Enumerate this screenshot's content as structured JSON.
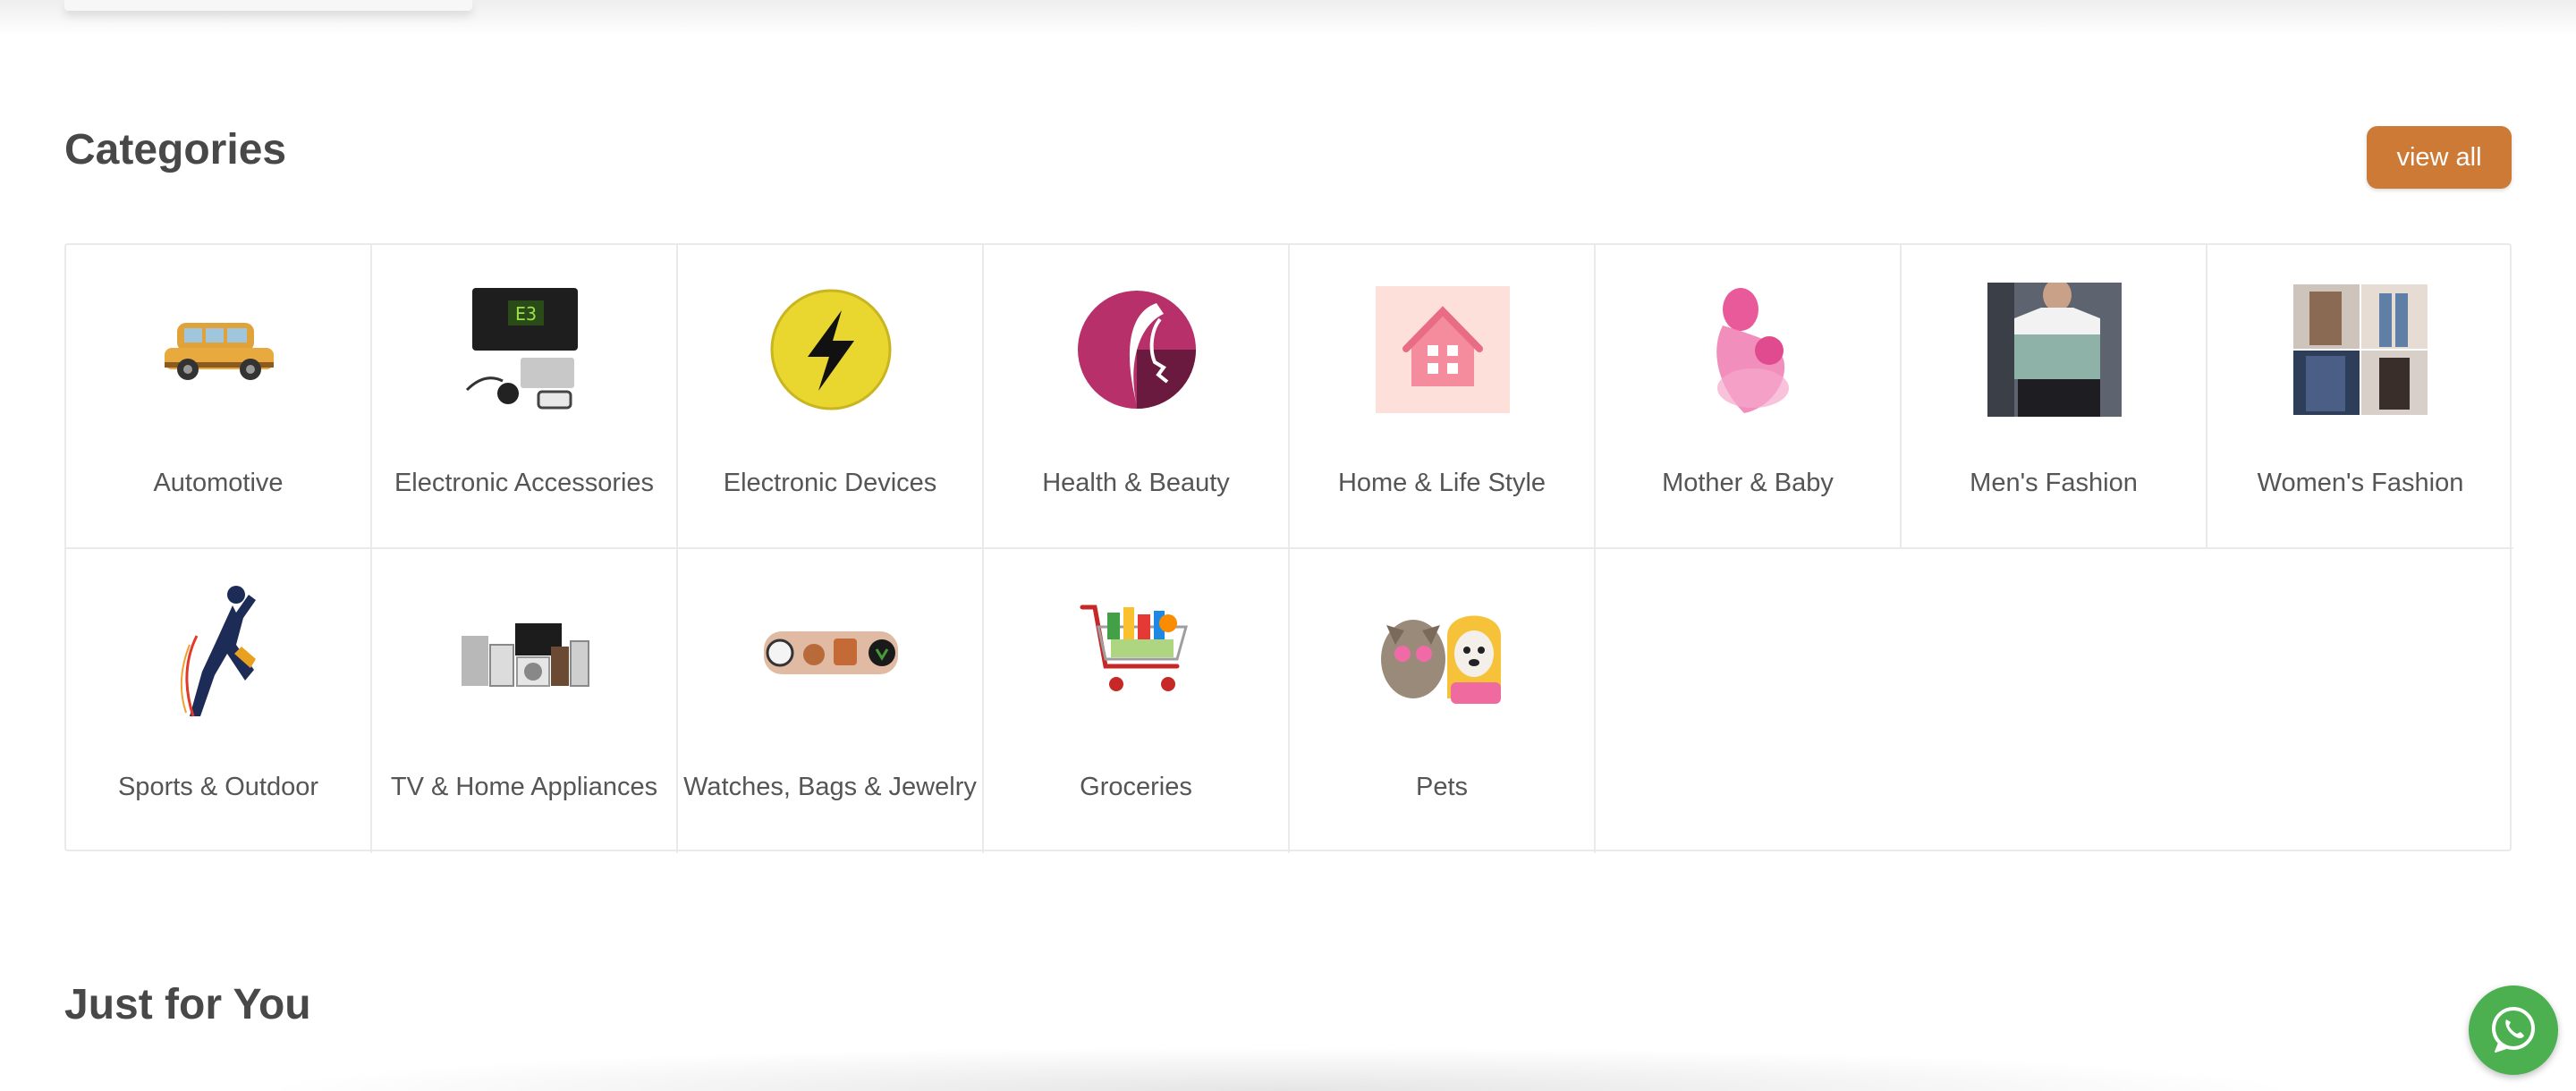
{
  "categories_section": {
    "title": "Categories",
    "view_all_label": "view all",
    "items": [
      {
        "label": "Automotive",
        "icon": "car-icon"
      },
      {
        "label": "Electronic Accessories",
        "icon": "electronic-accessories-icon"
      },
      {
        "label": "Electronic Devices",
        "icon": "lightning-icon"
      },
      {
        "label": "Health & Beauty",
        "icon": "woman-profile-icon"
      },
      {
        "label": "Home & Life Style",
        "icon": "house-icon"
      },
      {
        "label": "Mother & Baby",
        "icon": "mother-baby-icon"
      },
      {
        "label": "Men's Fashion",
        "icon": "mens-fashion-photo"
      },
      {
        "label": "Women's Fashion",
        "icon": "womens-fashion-photo"
      },
      {
        "label": "Sports & Outdoor",
        "icon": "athlete-icon"
      },
      {
        "label": "TV & Home Appliances",
        "icon": "appliances-icon"
      },
      {
        "label": "Watches, Bags & Jewelry",
        "icon": "watches-icon"
      },
      {
        "label": "Groceries",
        "icon": "shopping-cart-icon"
      },
      {
        "label": "Pets",
        "icon": "pets-icon"
      }
    ]
  },
  "just_for_you": {
    "title": "Just for You"
  },
  "colors": {
    "accent": "#cd7a36",
    "whatsapp": "#4caf50",
    "grid_border": "#eaeaea"
  }
}
